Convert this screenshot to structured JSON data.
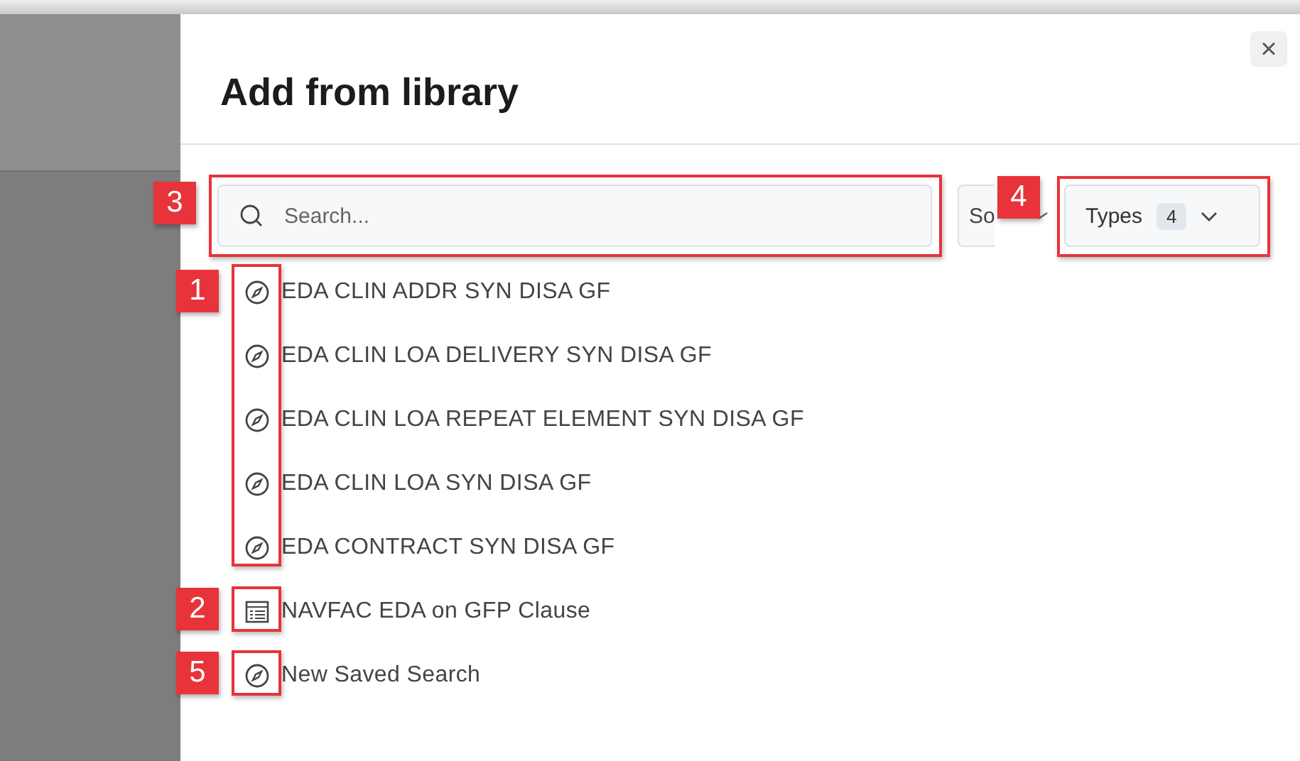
{
  "dialog": {
    "title": "Add from library",
    "close": "×"
  },
  "search": {
    "placeholder": "Search..."
  },
  "sort": {
    "label": "So"
  },
  "types": {
    "label": "Types",
    "count": "4"
  },
  "items": [
    {
      "kind": "search",
      "label": "EDA CLIN ADDR SYN DISA GF"
    },
    {
      "kind": "search",
      "label": "EDA CLIN LOA DELIVERY SYN DISA GF"
    },
    {
      "kind": "search",
      "label": "EDA CLIN LOA REPEAT ELEMENT SYN DISA GF"
    },
    {
      "kind": "search",
      "label": "EDA CLIN LOA SYN DISA GF"
    },
    {
      "kind": "search",
      "label": "EDA CONTRACT SYN DISA GF"
    },
    {
      "kind": "table",
      "label": "NAVFAC EDA on GFP Clause"
    },
    {
      "kind": "search",
      "label": "New Saved Search"
    }
  ],
  "annotations": [
    {
      "kind": "search",
      "label": "3"
    },
    {
      "kind": "types",
      "label": "4"
    },
    {
      "kind": "icons",
      "label": "1"
    },
    {
      "kind": "table",
      "label": "2"
    },
    {
      "kind": "last",
      "label": "5"
    }
  ]
}
